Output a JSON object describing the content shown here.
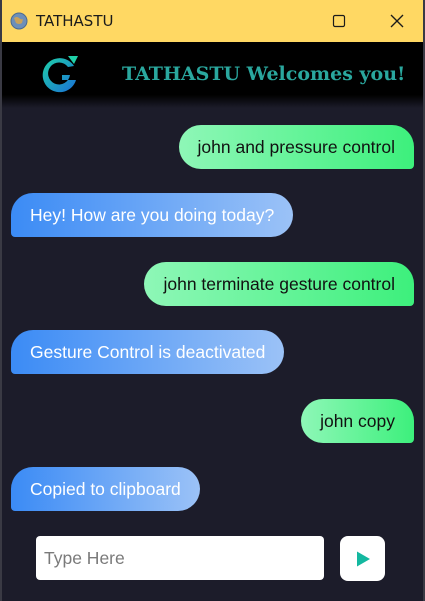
{
  "window": {
    "title": "TATHASTU",
    "titlebar_color": "#ffd863"
  },
  "header": {
    "welcome_text": "TATHASTU Welcomes you!",
    "welcome_color": "#2aa79e",
    "logo": "tathastu-logo"
  },
  "messages": [
    {
      "sender": "user",
      "text": "john and pressure control"
    },
    {
      "sender": "bot",
      "text": "Hey! How are you doing today?"
    },
    {
      "sender": "user",
      "text": "john terminate gesture control"
    },
    {
      "sender": "bot",
      "text": "Gesture Control is deactivated"
    },
    {
      "sender": "user",
      "text": "john copy"
    },
    {
      "sender": "bot",
      "text": "Copied to clipboard"
    }
  ],
  "input": {
    "placeholder": "Type Here",
    "value": ""
  },
  "send_button": {
    "icon": "play-triangle-icon",
    "color": "#14b8a0"
  },
  "icons": {
    "app": "globe-icon",
    "minimize": "minimize-icon",
    "maximize": "maximize-icon",
    "close": "close-icon"
  }
}
